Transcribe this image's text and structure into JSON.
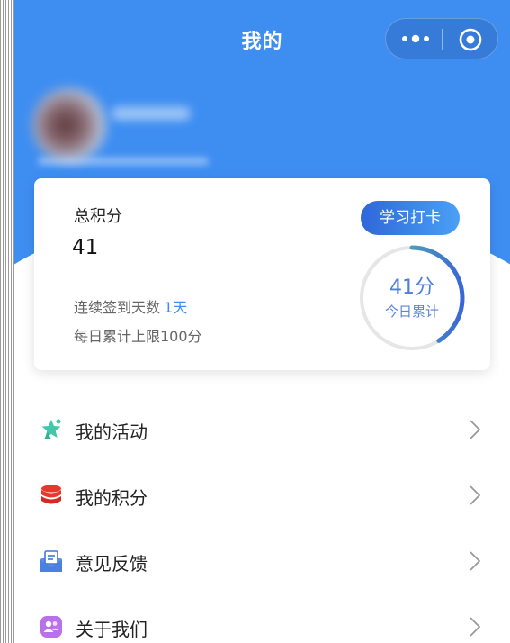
{
  "nav": {
    "title": "我的",
    "more_icon": "more-dots-icon",
    "close_icon": "mini-program-close-icon"
  },
  "points_card": {
    "title": "总积分",
    "total": "41",
    "streak_label": "连续签到天数",
    "streak_value": "1天",
    "daily_limit": "每日累计上限100分",
    "checkin_button": "学习打卡",
    "today_points": "41分",
    "today_label": "今日累计",
    "today_progress": 0.41
  },
  "menu": {
    "items": [
      {
        "label": "我的活动",
        "icon": "star-badge-icon"
      },
      {
        "label": "我的积分",
        "icon": "coin-stack-icon"
      },
      {
        "label": "意见反馈",
        "icon": "feedback-mail-icon"
      },
      {
        "label": "关于我们",
        "icon": "about-us-icon"
      }
    ]
  },
  "colors": {
    "header_blue": "#3e8ef2",
    "accent_blue": "#3e8ef2",
    "ring_green": "#5ed39a",
    "ring_blue": "#3a66d6"
  }
}
